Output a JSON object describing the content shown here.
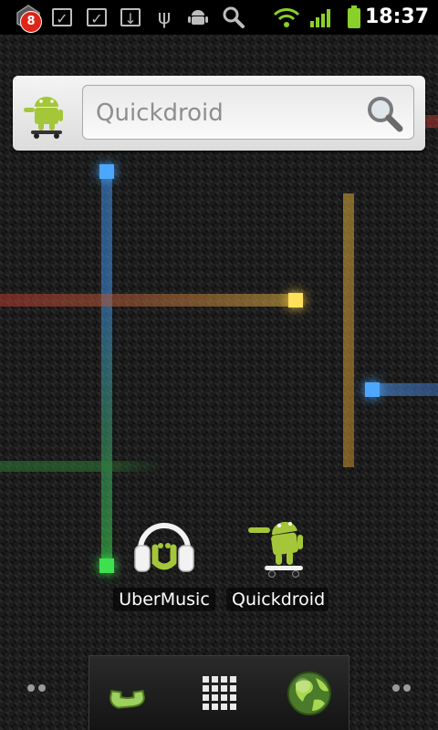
{
  "status_bar": {
    "notification_count": "8",
    "time": "18:37",
    "icons": [
      "notification-icon",
      "task-done-icon",
      "task-done-icon",
      "download-icon",
      "usb-icon",
      "android-debug-icon",
      "search-icon",
      "wifi-icon",
      "signal-icon",
      "battery-icon"
    ]
  },
  "search_widget": {
    "placeholder": "Quickdroid",
    "search_button_icon": "search-icon"
  },
  "apps": [
    {
      "label": "UberMusic",
      "icon": "headphones-icon"
    },
    {
      "label": "Quickdroid",
      "icon": "android-skateboard-icon"
    }
  ],
  "dock": {
    "left": "phone-icon",
    "center": "app-drawer-icon",
    "right": "browser-globe-icon"
  },
  "colors": {
    "status_bar": "#000000",
    "android_green": "#a4c639",
    "badge_red": "#e02418"
  }
}
